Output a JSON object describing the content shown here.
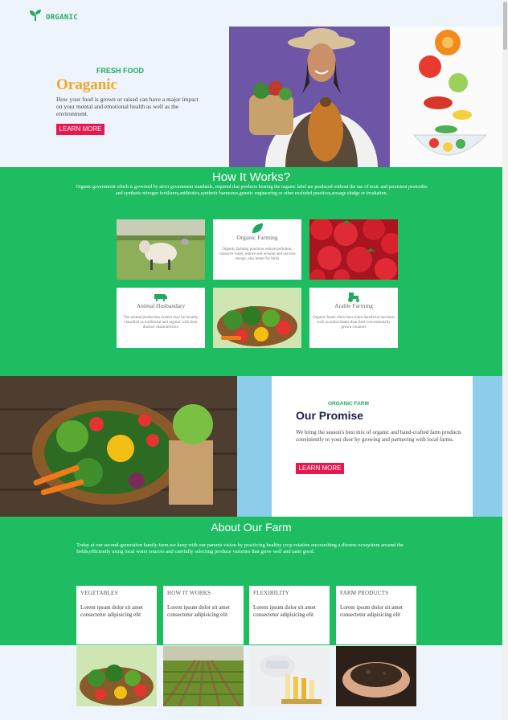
{
  "nav": {
    "brand": "ORGANIC",
    "logo_icon": "sprout-icon"
  },
  "hero": {
    "eyebrow": "FRESH FOOD",
    "title": "Oraganic",
    "description": "How your food is grown or raised can have a major impact on your mental and emotional health as well as the environment.",
    "button": "LEARN MORE"
  },
  "how": {
    "title": "How It Works?",
    "intro": "Organic government which is governed by strict government standards, required that products bearing the organic label are produced without the use of toxic and persistent pesticides and synthetic nitrogen fertilizers,antibiotics,synthetic harmones,genetic engineering or other excluded practices,sewage sludge or irradiation.",
    "cards": [
      {
        "icon": "leaf-icon",
        "title": "Organic Farming",
        "text": "Organic farming practices reduce pollution, conserve water, reduce soil erosion and use less energy, also better for birds"
      },
      {
        "icon": "cow-icon",
        "title": "Animal Husbandary",
        "text": "The animal production system may be broadly classified as traditional and organic with their distinct characteristics"
      },
      {
        "icon": "tractor-icon",
        "title": "Arable Farming",
        "text": "Organic foods often have more beneficial nutrients such as antioxidants than their conventionally grown counters"
      }
    ]
  },
  "promise": {
    "eyebrow": "ORGANIC FARM",
    "title": "Our Promise",
    "description": "We bring the season's best mix of organic and hand-crafted farm products conviniently to your door by growing and partnering with local farms.",
    "button": "LEARN MORE"
  },
  "about": {
    "title": "About Our Farm",
    "intro": "Today at our second-generation family farm,we keep with our parents vision by practicing healthy crop rotation encourshing a diverse ecosystem around the fields,efficiently using local water sources and carefully selecting produce varieties that grow well and taste good.",
    "cards": [
      {
        "title": "VEGETABLES",
        "text": "Lorem ipsum dolor sit amet consectetur adipisicing elit"
      },
      {
        "title": "HOW IT WORKS",
        "text": "Lorem ipsum dolor sit amet consectetur adipisicing elit"
      },
      {
        "title": "FLEXIBILITY",
        "text": "Lorem ipsum dolor sit amet consectetur adipisicing elit"
      },
      {
        "title": "FARM PRODUCTS",
        "text": "Lorem ipsum dolor sit amet consectetur adipisicing elit"
      }
    ]
  },
  "colors": {
    "brand_green": "#1ebd62",
    "accent_orange": "#f5a623",
    "button_red": "#e8184f",
    "navy": "#1b1f4e",
    "sky_blue": "#8ccdec"
  }
}
